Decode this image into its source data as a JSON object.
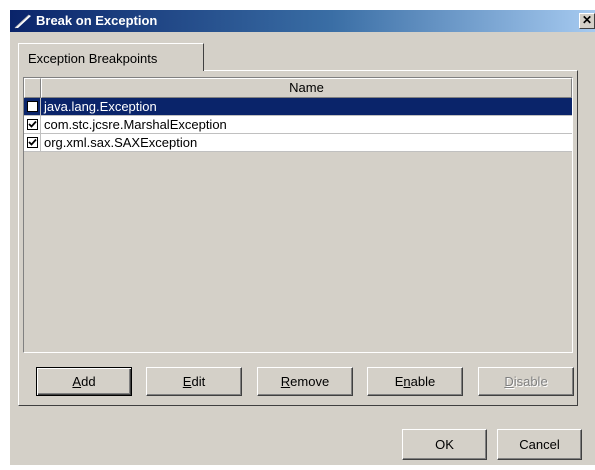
{
  "window": {
    "title": "Break on Exception",
    "close_glyph": "✕",
    "icon": "feather-icon"
  },
  "tabs": [
    {
      "label": "Exception Breakpoints",
      "active": true
    }
  ],
  "table": {
    "columns": [
      "",
      "Name"
    ],
    "rows": [
      {
        "checked": false,
        "name": "java.lang.Exception",
        "selected": true
      },
      {
        "checked": true,
        "name": "com.stc.jcsre.MarshalException",
        "selected": false
      },
      {
        "checked": true,
        "name": "org.xml.sax.SAXException",
        "selected": false
      }
    ]
  },
  "buttons": {
    "add": {
      "mnemonic": "A",
      "rest": "dd",
      "enabled": true
    },
    "edit": {
      "mnemonic": "E",
      "rest": "dit",
      "enabled": true
    },
    "remove": {
      "mnemonic": "R",
      "rest": "emove",
      "enabled": true
    },
    "enable": {
      "pre": "E",
      "mnemonic": "n",
      "rest": "able",
      "enabled": true
    },
    "disable": {
      "mnemonic": "D",
      "rest": "isable",
      "enabled": false
    },
    "ok": "OK",
    "cancel": "Cancel"
  },
  "colors": {
    "title_bar_start": "#0a246a",
    "title_bar_end": "#a6caf0",
    "dialog_bg": "#d4d0c8",
    "selection": "#0a246a"
  }
}
